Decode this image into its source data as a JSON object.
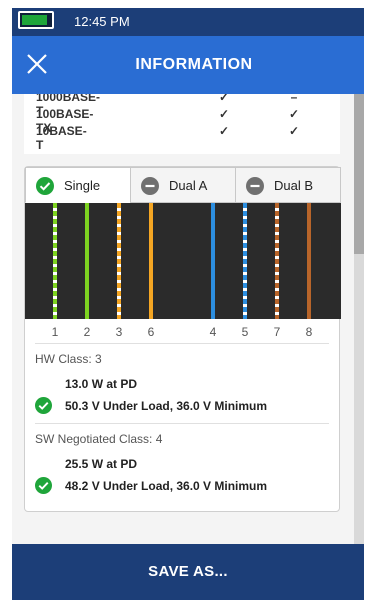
{
  "status_bar": {
    "time": "12:45 PM",
    "battery_level": 0.9
  },
  "header": {
    "title": "INFORMATION"
  },
  "speed_table": {
    "rows": [
      {
        "name": "1000BASE-T",
        "col1": "✓",
        "col2": "–"
      },
      {
        "name": "100BASE-TX",
        "col1": "✓",
        "col2": "✓"
      },
      {
        "name": "10BASE-T",
        "col1": "✓",
        "col2": "✓"
      }
    ]
  },
  "tabs": [
    {
      "label": "Single",
      "state": "ok"
    },
    {
      "label": "Dual A",
      "state": "off"
    },
    {
      "label": "Dual B",
      "state": "off"
    }
  ],
  "wires": [
    {
      "pin": "1",
      "color": "#7ed321",
      "striped": true
    },
    {
      "pin": "2",
      "color": "#7ed321",
      "striped": false
    },
    {
      "pin": "3",
      "color": "#f5a623",
      "striped": true
    },
    {
      "pin": "6",
      "color": "#f5a623",
      "striped": false
    },
    {
      "pin": "4",
      "color": "#2d8fe0",
      "striped": false
    },
    {
      "pin": "5",
      "color": "#2d8fe0",
      "striped": true
    },
    {
      "pin": "7",
      "color": "#b8652a",
      "striped": true
    },
    {
      "pin": "8",
      "color": "#b8652a",
      "striped": false
    }
  ],
  "hw": {
    "class_label": "HW Class: 3",
    "power": "13.0 W at PD",
    "voltage": "50.3 V Under Load, 36.0 V Minimum"
  },
  "sw": {
    "class_label": "SW Negotiated Class: 4",
    "power": "25.5 W at PD",
    "voltage": "48.2 V Under Load, 36.0 V Minimum"
  },
  "footer": {
    "label": "SAVE AS..."
  },
  "colors": {
    "header": "#2a6dd3",
    "status_bar": "#1c3e78",
    "ok_green": "#1fa53a",
    "disabled_gray": "#707070"
  }
}
